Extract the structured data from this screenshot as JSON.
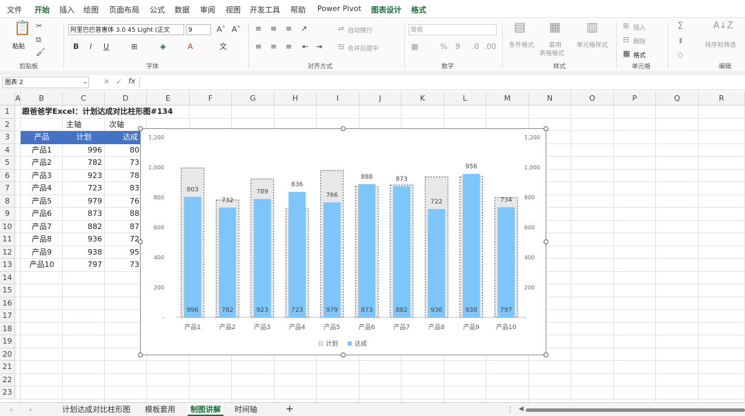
{
  "menu": {
    "items": [
      "文件",
      "开始",
      "插入",
      "绘图",
      "页面布局",
      "公式",
      "数据",
      "审阅",
      "视图",
      "开发工具",
      "帮助",
      "Power Pivot",
      "图表设计",
      "格式"
    ]
  },
  "ribbon": {
    "font_name": "阿里巴巴普惠体 3.0 45 Light (正文",
    "font_size": "9",
    "paste_label": "粘贴",
    "number_format": "常规",
    "wrap_label": "自动换行",
    "merge_label": "合并后居中",
    "cond_format": "条件格式",
    "table_format_1": "套用",
    "table_format_2": "表格格式",
    "cell_style": "单元格样式",
    "insert_label": "插入",
    "delete_label": "删除",
    "format_label": "格式",
    "sort_filter": "排序和筛选",
    "groups": [
      "剪贴板",
      "字体",
      "对齐方式",
      "数字",
      "样式",
      "单元格",
      "编辑"
    ]
  },
  "formula_bar": {
    "name_box": "图表 2",
    "fx": "fx",
    "value": ""
  },
  "columns": [
    "A",
    "B",
    "C",
    "D",
    "E",
    "F",
    "G",
    "H",
    "I",
    "J",
    "K",
    "L",
    "M",
    "N",
    "O",
    "P",
    "Q",
    "R"
  ],
  "rows": [
    "1",
    "2",
    "3",
    "4",
    "5",
    "6",
    "7",
    "8",
    "9",
    "10",
    "11",
    "12",
    "13",
    "14",
    "15",
    "16",
    "17",
    "18",
    "19",
    "20",
    "21",
    "22",
    "23"
  ],
  "sheet": {
    "title": "跟爸爸学Excel：计划达成对比柱形图#134",
    "axis_main": "主轴",
    "axis_sub": "次轴",
    "headers": [
      "产品",
      "计划",
      "达成"
    ],
    "table": [
      [
        "产品1",
        "996",
        "80"
      ],
      [
        "产品2",
        "782",
        "73"
      ],
      [
        "产品3",
        "923",
        "78"
      ],
      [
        "产品4",
        "723",
        "83"
      ],
      [
        "产品5",
        "979",
        "76"
      ],
      [
        "产品6",
        "873",
        "88"
      ],
      [
        "产品7",
        "882",
        "87"
      ],
      [
        "产品8",
        "936",
        "72"
      ],
      [
        "产品9",
        "938",
        "95"
      ],
      [
        "产品10",
        "797",
        "73"
      ]
    ]
  },
  "chart_data": {
    "type": "bar",
    "categories": [
      "产品1",
      "产品2",
      "产品3",
      "产品4",
      "产品5",
      "产品6",
      "产品7",
      "产品8",
      "产品9",
      "产品10"
    ],
    "series": [
      {
        "name": "计划",
        "values": [
          996,
          782,
          923,
          723,
          979,
          873,
          882,
          936,
          938,
          797
        ],
        "color": "#e8e8e8"
      },
      {
        "name": "达成",
        "values": [
          803,
          732,
          789,
          836,
          766,
          888,
          873,
          722,
          956,
          734
        ],
        "color": "#7dc5fa"
      }
    ],
    "ylim": [
      0,
      1200
    ],
    "yticks": [
      "-",
      "200",
      "400",
      "600",
      "800",
      "1,000",
      "1,200"
    ],
    "y_right_ticks": [
      "-",
      "200",
      "400",
      "600",
      "800",
      "1,000",
      "1,200"
    ],
    "legend": "bottom",
    "grid": false
  },
  "tabs": [
    "计划达成对比柱形图",
    "模板套用",
    "制图讲解",
    "时间轴"
  ],
  "active_tab": "制图讲解",
  "add_sheet": "+"
}
